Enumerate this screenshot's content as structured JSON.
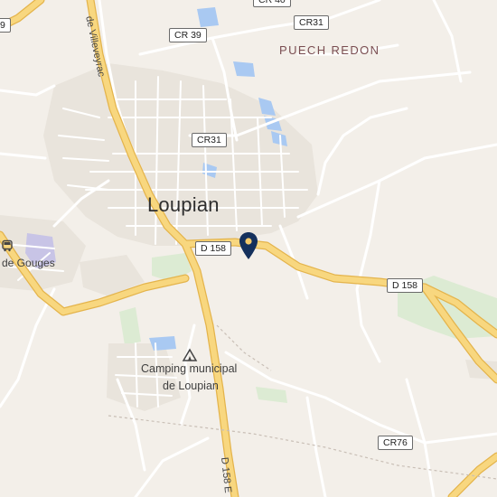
{
  "map": {
    "places": {
      "town": "Loupian",
      "locality": "PUECH REDON",
      "camping_line1": "Camping municipal",
      "camping_line2": "de Loupian",
      "gouges": "de Gouges"
    },
    "road_labels": {
      "villeveyrac": "de Villeveyrac",
      "d158_vertical": "D 158 E"
    },
    "shields": {
      "cr39": "CR 39",
      "cr31_top": "CR31",
      "cr31_mid": "CR31",
      "d158_west": "D 158",
      "d158_east": "D 158",
      "cr76": "CR76",
      "top_partial": "CR 40",
      "left_partial": "9"
    },
    "icons": {
      "marker": "location-pin-icon",
      "camping": "campground-icon",
      "bus": "bus-stop-icon"
    },
    "colors": {
      "land": "#f3efe9",
      "major_road": "#f7d57d",
      "major_road_casing": "#e6b94e",
      "minor_road": "#ffffff",
      "water": "#a6c8f0",
      "park": "#d9ead0",
      "marker": "#14305c"
    }
  }
}
